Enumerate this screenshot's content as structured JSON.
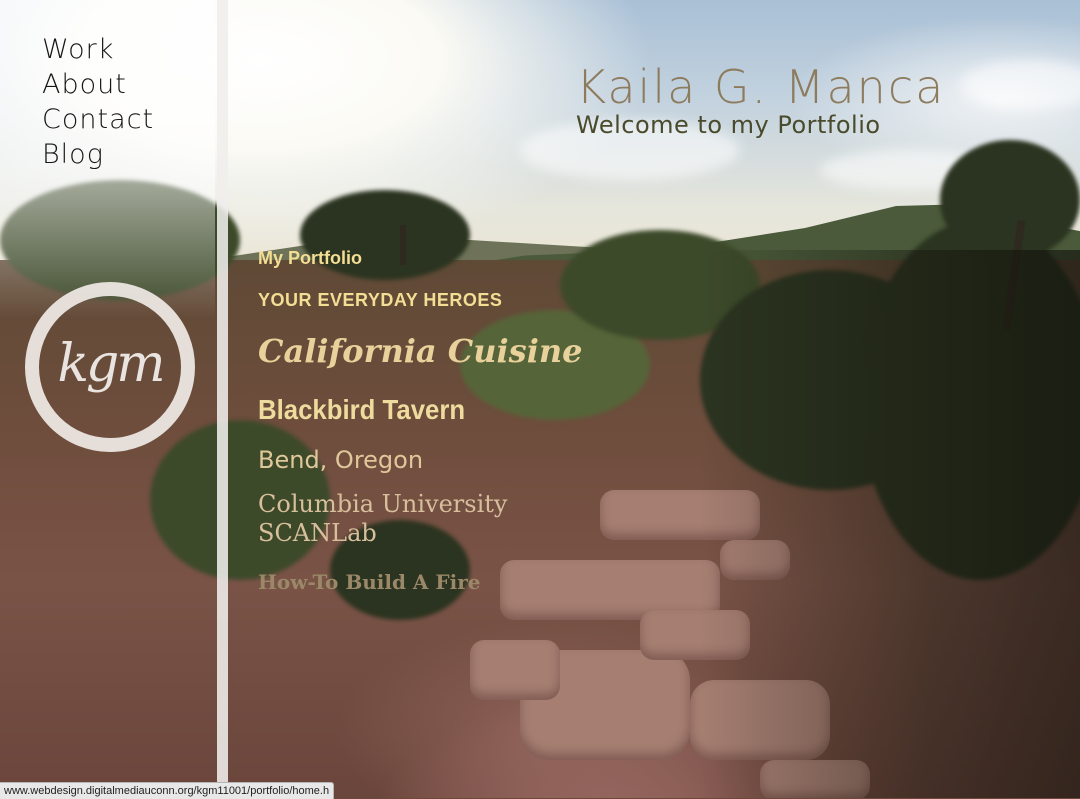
{
  "nav": {
    "items": [
      {
        "label": "Work"
      },
      {
        "label": "About"
      },
      {
        "label": "Contact"
      },
      {
        "label": "Blog"
      }
    ]
  },
  "logo": {
    "text": "kgm"
  },
  "header": {
    "title": "Kaila G. Manca",
    "subtitle": "Welcome to my Portfolio"
  },
  "projects": {
    "my_portfolio": "My Portfolio",
    "everyday_heroes": "YOUR EVERYDAY HEROES",
    "california_cuisine": "California Cuisine",
    "blackbird_tavern": "Blackbird Tavern",
    "bend_oregon": "Bend, Oregon",
    "columbia_line1": "Columbia University",
    "columbia_line2": "SCANLab",
    "build_fire": "How-To Build A Fire"
  },
  "status_bar": {
    "url": "www.webdesign.digitalmediauconn.org/kgm11001/portfolio/home.h"
  }
}
